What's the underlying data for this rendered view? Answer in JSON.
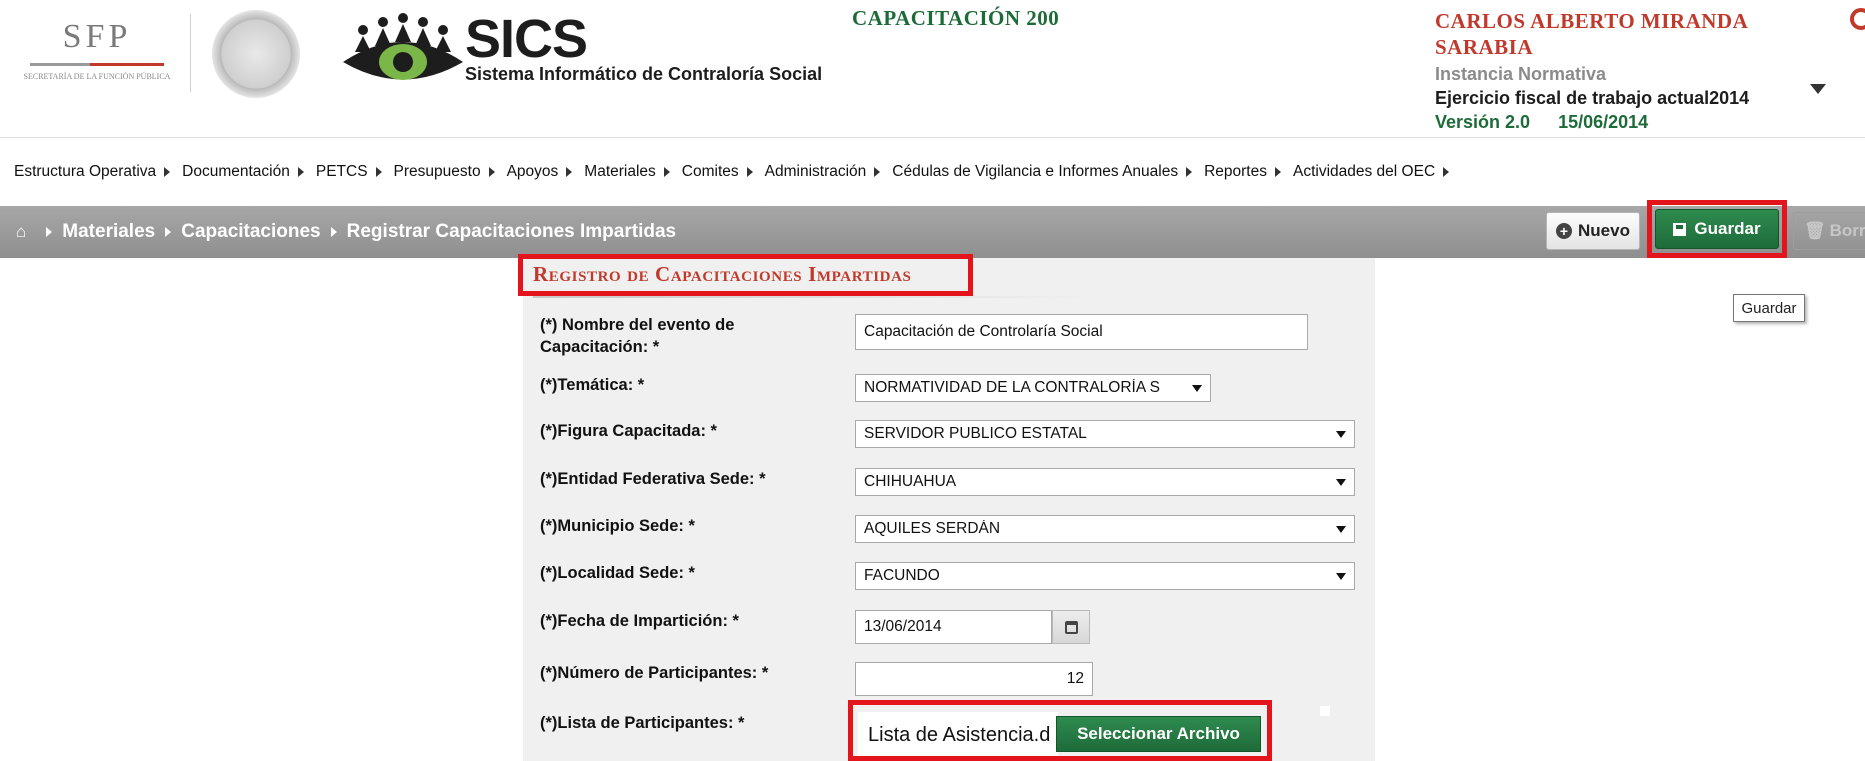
{
  "header": {
    "sfp": {
      "acronym": "SFP",
      "subtitle": "Secretaría de la Función Pública"
    },
    "app": {
      "name": "SICS",
      "full_name": "Sistema Informático de Contraloría Social"
    },
    "course_title": "CAPACITACIÓN 200",
    "user": {
      "name": "CARLOS ALBERTO MIRANDA SARABIA",
      "role": "Instancia Normativa",
      "fiscal_year": "Ejercicio fiscal de trabajo actual2014",
      "version": "Versión 2.0",
      "date": "15/06/2014"
    }
  },
  "menu": [
    {
      "label": "Estructura Operativa"
    },
    {
      "label": "Documentación"
    },
    {
      "label": "PETCS"
    },
    {
      "label": "Presupuesto"
    },
    {
      "label": "Apoyos"
    },
    {
      "label": "Materiales"
    },
    {
      "label": "Comites"
    },
    {
      "label": "Administración"
    },
    {
      "label": "Cédulas de Vigilancia e Informes Anuales"
    },
    {
      "label": "Reportes"
    },
    {
      "label": "Actividades del OEC"
    }
  ],
  "breadcrumb": {
    "home_icon": "home-icon",
    "items": [
      "Materiales",
      "Capacitaciones",
      "Registrar Capacitaciones Impartidas"
    ]
  },
  "toolbar": {
    "new_label": "Nuevo",
    "save_label": "Guardar",
    "delete_label": "Borrar",
    "tooltip": "Guardar"
  },
  "form": {
    "title": "Registro de Capacitaciones Impartidas",
    "fields": {
      "event_name": {
        "label": "(*) Nombre del evento de Capacitación: *",
        "value": "Capacitación de Controlaría Social"
      },
      "topic": {
        "label": "(*)Temática: *",
        "value": "NORMATIVIDAD DE LA CONTRALORÍA S"
      },
      "trained_figure": {
        "label": "(*)Figura Capacitada: *",
        "value": "SERVIDOR PUBLICO ESTATAL"
      },
      "state": {
        "label": "(*)Entidad Federativa Sede: *",
        "value": "CHIHUAHUA"
      },
      "municipality": {
        "label": "(*)Municipio Sede: *",
        "value": "AQUILES SERDÁN"
      },
      "locality": {
        "label": "(*)Localidad Sede: *",
        "value": "FACUNDO"
      },
      "date": {
        "label": "(*)Fecha de Impartición: *",
        "value": "13/06/2014"
      },
      "participants": {
        "label": "(*)Número de Participantes: *",
        "value": "12"
      },
      "participants_list": {
        "label": "(*)Lista de Participantes: *",
        "file_name": "Lista de Asistencia.d",
        "button": "Seleccionar Archivo"
      }
    }
  },
  "colors": {
    "accent_green": "#1e6b3a",
    "accent_red": "#c0392b",
    "highlight_red": "#e3141c",
    "bar_gray": "#999999"
  }
}
